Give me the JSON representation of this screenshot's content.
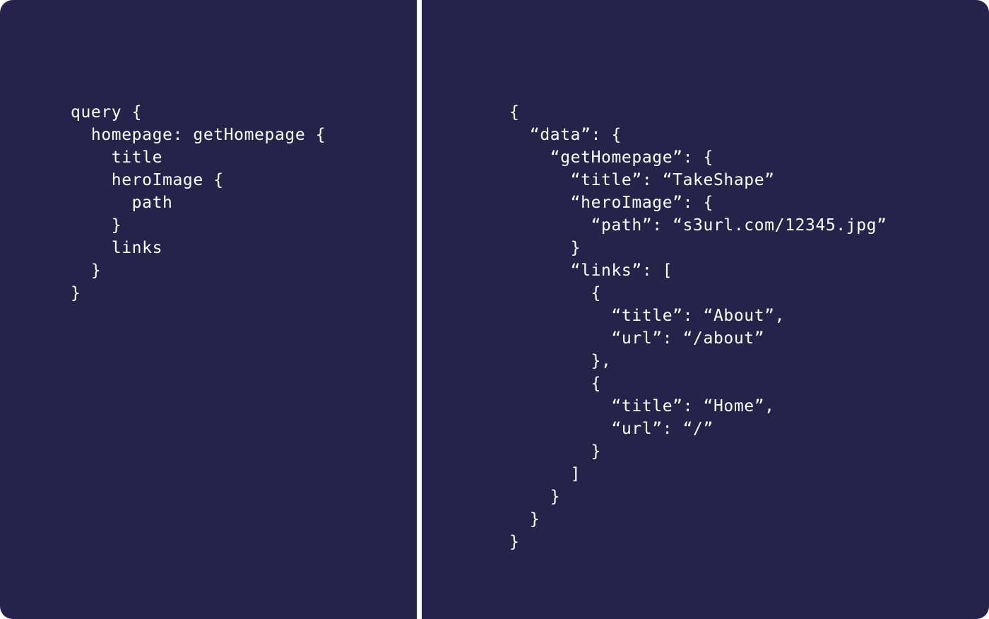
{
  "colors": {
    "panel_background": "#272249",
    "divider": "#ffffff",
    "text": "#ffffff"
  },
  "query_panel": {
    "lines": [
      "query {",
      "  homepage: getHomepage {",
      "    title",
      "    heroImage {",
      "      path",
      "    }",
      "    links",
      "  }",
      "}"
    ]
  },
  "response_panel": {
    "lines": [
      "{",
      "  “data”: {",
      "    “getHomepage”: {",
      "      “title”: “TakeShape”",
      "      “heroImage”: {",
      "        “path”: “s3url.com/12345.jpg”",
      "      }",
      "      “links”: [",
      "        {",
      "          “title”: “About”,",
      "          “url”: “/about”",
      "        },",
      "        {",
      "          “title”: “Home”,",
      "          “url”: “/”",
      "        }",
      "      ]",
      "    }",
      "  }",
      "}"
    ]
  }
}
